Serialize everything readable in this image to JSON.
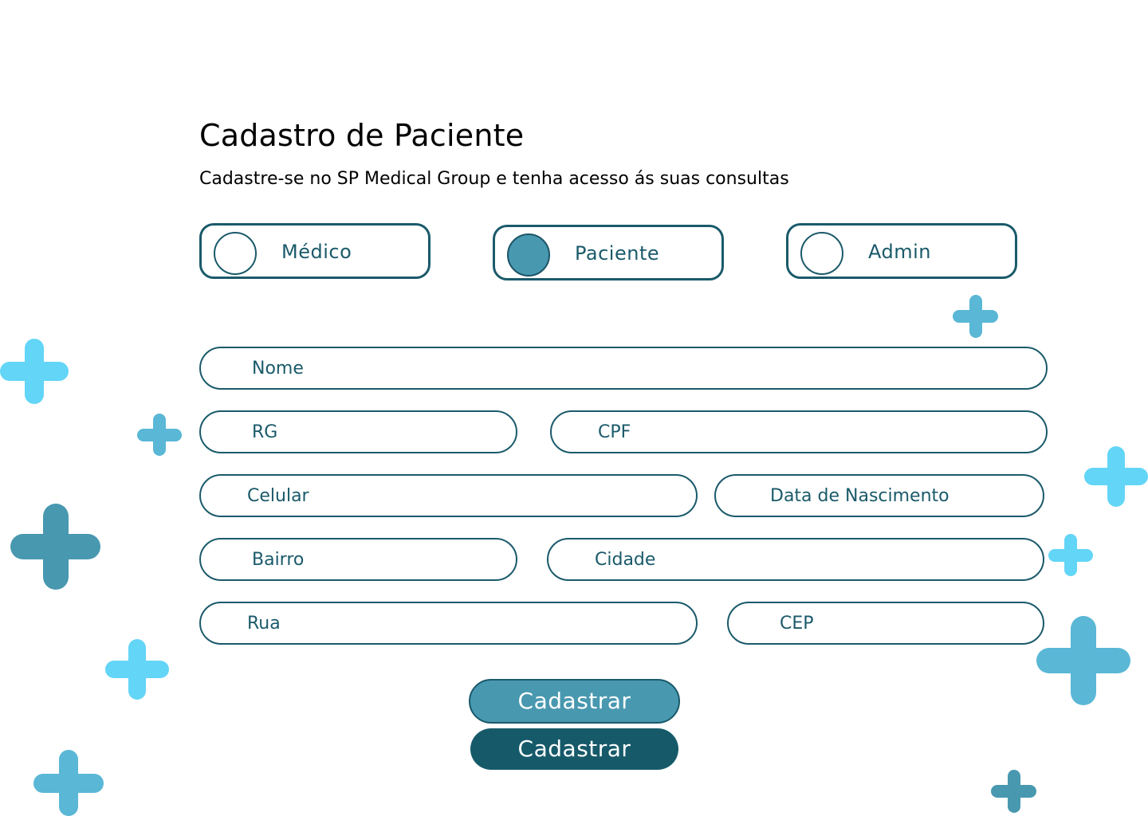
{
  "header": {
    "title": "Cadastro de Paciente",
    "subtitle": "Cadastre-se no SP Medical Group e tenha acesso ás suas consultas"
  },
  "roles": [
    {
      "label": "Médico",
      "selected": false
    },
    {
      "label": "Paciente",
      "selected": true
    },
    {
      "label": "Admin",
      "selected": false
    }
  ],
  "form": {
    "nome": {
      "placeholder": "Nome",
      "value": ""
    },
    "rg": {
      "placeholder": "RG",
      "value": ""
    },
    "cpf": {
      "placeholder": "CPF",
      "value": ""
    },
    "celular": {
      "placeholder": "Celular",
      "value": ""
    },
    "data_nascimento": {
      "placeholder": "Data de Nascimento",
      "value": ""
    },
    "bairro": {
      "placeholder": "Bairro",
      "value": ""
    },
    "cidade": {
      "placeholder": "Cidade",
      "value": ""
    },
    "rua": {
      "placeholder": "Rua",
      "value": ""
    },
    "cep": {
      "placeholder": "CEP",
      "value": ""
    }
  },
  "buttons": {
    "primary_label": "Cadastrar",
    "secondary_label": "Cadastrar"
  },
  "colors": {
    "accent": "#4898b0",
    "dark_teal": "#165a6a",
    "light_cyan": "#63d5f7",
    "sky_blue": "#5ab7d6"
  },
  "decorations": {
    "icon": "plus-icon"
  }
}
